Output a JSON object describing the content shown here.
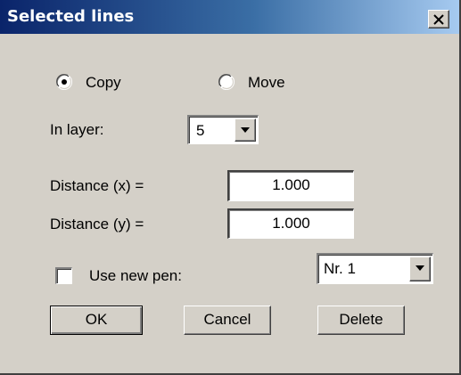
{
  "window": {
    "title": "Selected lines",
    "close_glyph": "close-icon",
    "colors": {
      "face": "#d4d0c8",
      "title_start": "#0a246a",
      "title_end": "#a6caf0"
    }
  },
  "mode": {
    "options": [
      {
        "label": "Copy",
        "selected": true
      },
      {
        "label": "Move",
        "selected": false
      }
    ]
  },
  "layer": {
    "label": "In layer:",
    "value": "5"
  },
  "distance_x": {
    "label": "Distance (x) =",
    "value": "1.000"
  },
  "distance_y": {
    "label": "Distance (y) =",
    "value": "1.000"
  },
  "pen": {
    "checkbox_label": "Use new pen:",
    "checked": false,
    "value": "Nr. 1"
  },
  "buttons": {
    "ok": "OK",
    "cancel": "Cancel",
    "delete": "Delete"
  }
}
